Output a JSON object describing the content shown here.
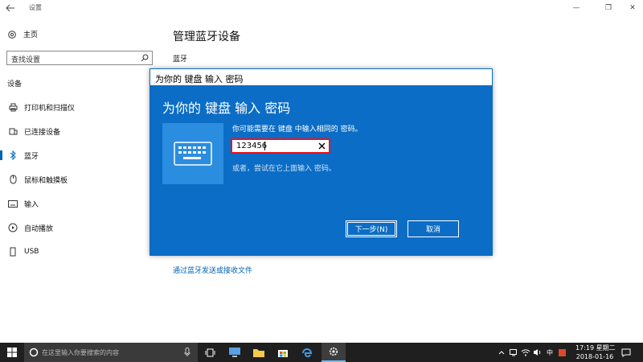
{
  "window": {
    "title": "设置",
    "minimize_glyph": "—",
    "maximize_glyph": "❐",
    "close_glyph": "✕"
  },
  "sidebar": {
    "home_label": "主页",
    "search_placeholder": "查找设置",
    "section": "设备",
    "items": [
      {
        "label": "打印机和扫描仪",
        "icon": "printer-icon"
      },
      {
        "label": "已连接设备",
        "icon": "devices-icon"
      },
      {
        "label": "蓝牙",
        "icon": "bluetooth-icon",
        "active": true
      },
      {
        "label": "鼠标和触摸板",
        "icon": "mouse-icon"
      },
      {
        "label": "输入",
        "icon": "keyboard-icon"
      },
      {
        "label": "自动播放",
        "icon": "autoplay-icon"
      },
      {
        "label": "USB",
        "icon": "usb-icon"
      }
    ]
  },
  "main": {
    "title": "管理蓝牙设备",
    "bluetooth_label": "蓝牙",
    "send_receive_link": "通过蓝牙发送或接收文件"
  },
  "dialog": {
    "window_title": "为你的 键盘 输入 密码",
    "heading": "为你的 键盘 输入 密码",
    "instruction": "你可能需要在 键盘 中输入相同的 密码。",
    "password_value": "123456",
    "alternative": "或者，尝试在它上面输入 密码。",
    "next_button": "下一步(N)",
    "cancel_button": "取消"
  },
  "taskbar": {
    "search_placeholder": "在这里输入你要搜索的内容",
    "ime": "中",
    "time": "17:19",
    "weekday": "星期二",
    "date": "2018-01-16"
  },
  "colors": {
    "dialog_bg": "#0b6dc5",
    "accent": "#0063b1",
    "taskbar_bg": "#1f1f1f",
    "password_border": "#e81123"
  }
}
